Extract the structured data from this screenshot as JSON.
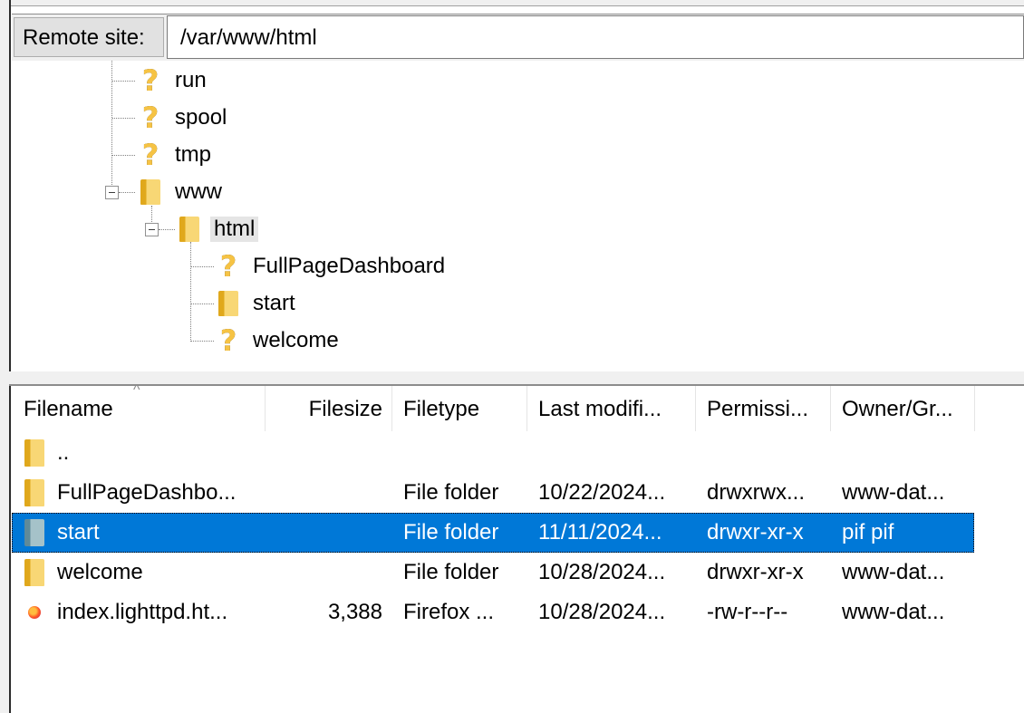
{
  "remote_site": {
    "label": "Remote site:",
    "path": "/var/www/html"
  },
  "tree": {
    "nodes": [
      {
        "label": "run",
        "icon": "question-mark-icon"
      },
      {
        "label": "spool",
        "icon": "question-mark-icon"
      },
      {
        "label": "tmp",
        "icon": "question-mark-icon"
      },
      {
        "label": "www",
        "icon": "folder-icon"
      },
      {
        "label": "html",
        "icon": "folder-icon"
      },
      {
        "label": "FullPageDashboard",
        "icon": "question-mark-icon"
      },
      {
        "label": "start",
        "icon": "folder-icon"
      },
      {
        "label": "welcome",
        "icon": "question-mark-icon"
      }
    ]
  },
  "filelist": {
    "columns": [
      "Filename",
      "Filesize",
      "Filetype",
      "Last modifi...",
      "Permissi...",
      "Owner/Gr..."
    ],
    "rows": [
      {
        "name": "..",
        "size": "",
        "type": "",
        "modified": "",
        "perms": "",
        "owner": "",
        "icon": "folder-icon"
      },
      {
        "name": "FullPageDashbo...",
        "size": "",
        "type": "File folder",
        "modified": "10/22/2024...",
        "perms": "drwxrwx...",
        "owner": "www-dat...",
        "icon": "folder-icon"
      },
      {
        "name": "start",
        "size": "",
        "type": "File folder",
        "modified": "11/11/2024...",
        "perms": "drwxr-xr-x",
        "owner": "pif pif",
        "icon": "folder-icon",
        "selected": true
      },
      {
        "name": "welcome",
        "size": "",
        "type": "File folder",
        "modified": "10/28/2024...",
        "perms": "drwxr-xr-x",
        "owner": "www-dat...",
        "icon": "folder-icon"
      },
      {
        "name": "index.lighttpd.ht...",
        "size": "3,388",
        "type": "Firefox ...",
        "modified": "10/28/2024...",
        "perms": "-rw-r--r--",
        "owner": "www-dat...",
        "icon": "firefox-icon"
      }
    ]
  },
  "colors": {
    "selection": "#0078d7",
    "folder": "#f8d775"
  }
}
